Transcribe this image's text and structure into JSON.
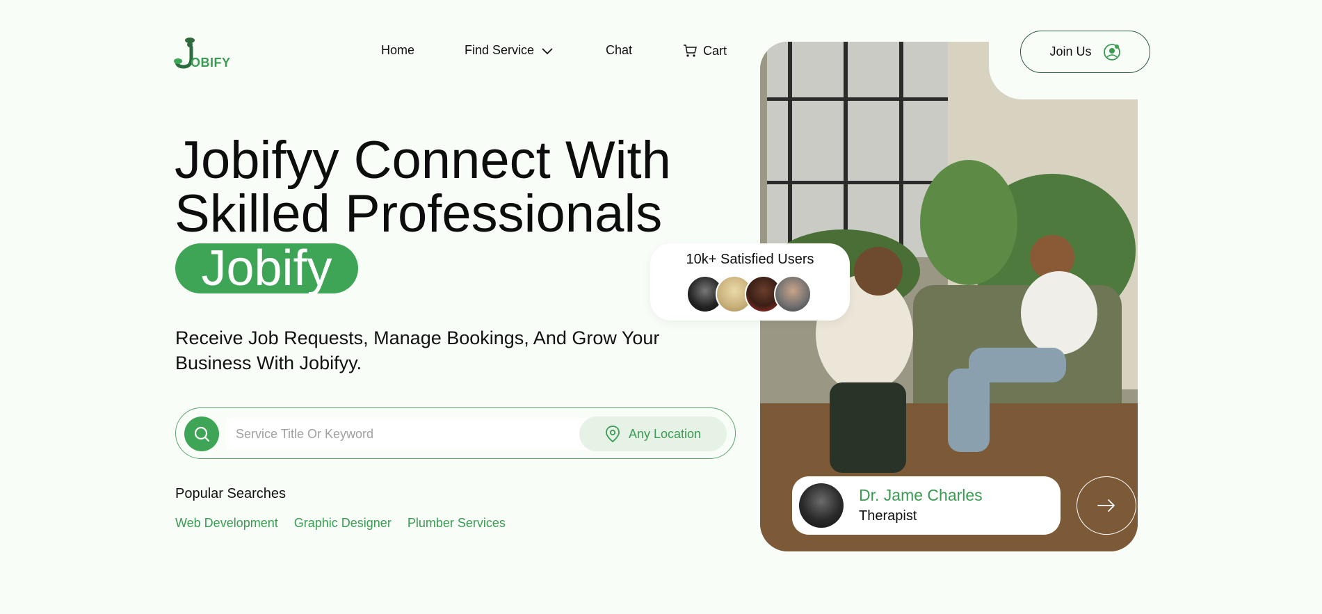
{
  "logo": {
    "text": "OBIFY",
    "icon": "jobify-logo-icon"
  },
  "nav": {
    "home": "Home",
    "find_service": "Find Service",
    "chat": "Chat",
    "cart": "Cart"
  },
  "join": {
    "label": "Join Us"
  },
  "hero": {
    "title_line1": "Jobifyy Connect With",
    "title_line2": "Skilled Professionals",
    "brand": "Jobify",
    "subtitle": "Receive Job Requests, Manage Bookings, And Grow Your Business With Jobifyy."
  },
  "search": {
    "placeholder": "Service Title Or Keyword",
    "location": "Any Location"
  },
  "popular": {
    "label": "Popular Searches",
    "tags": [
      "Web Development",
      "Graphic Designer",
      "Plumber Services"
    ]
  },
  "users_card": {
    "title": "10k+ Satisfied Users"
  },
  "doctor": {
    "name": "Dr. Jame Charles",
    "role": "Therapist"
  },
  "colors": {
    "accent": "#3ea556",
    "background": "#f8fdf7",
    "text": "#111111"
  }
}
